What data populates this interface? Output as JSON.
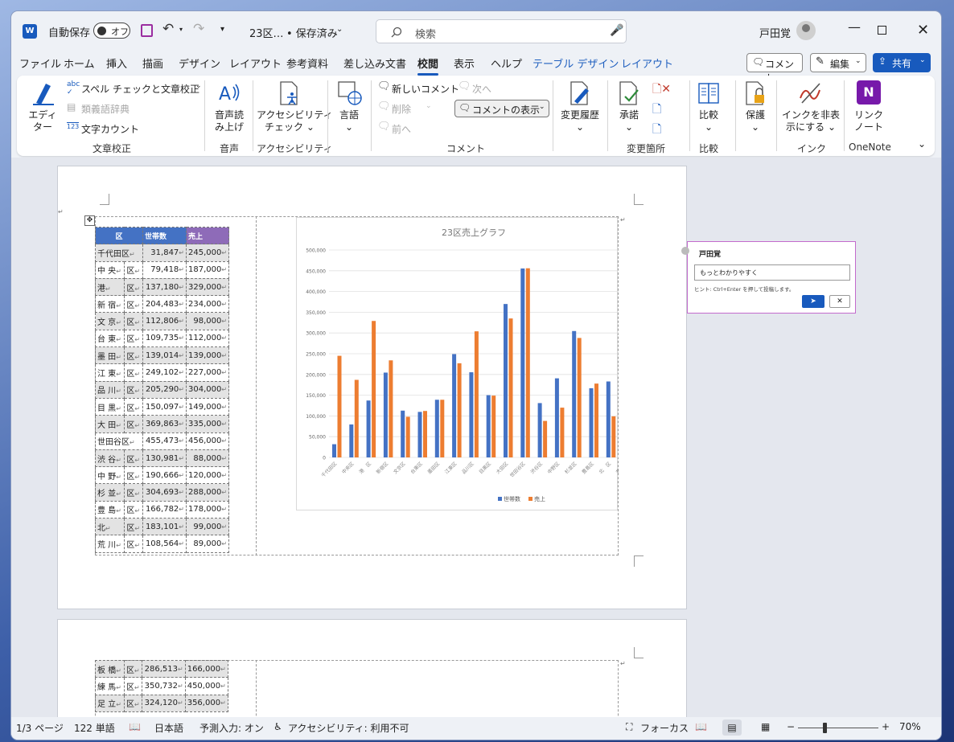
{
  "titlebar": {
    "autosave_label": "自動保存",
    "autosave_state": "オフ",
    "doc_title": "23区…",
    "save_state": "• 保存済み",
    "search_placeholder": "検索",
    "user_name": "戸田覚"
  },
  "tabs": [
    "ファイル",
    "ホーム",
    "挿入",
    "描画",
    "デザイン",
    "レイアウト",
    "参考資料",
    "差し込み文書",
    "校閲",
    "表示",
    "ヘルプ",
    "テーブル デザイン",
    "レイアウト"
  ],
  "tab_right": {
    "comment": "コメント",
    "edit": "編集",
    "share": "共有"
  },
  "ribbon": {
    "proofing": {
      "editor_l1": "エディ",
      "editor_l2": "ター",
      "spell": "スペル チェックと文章校正",
      "thesaurus": "類義語辞典",
      "wordcount": "文字カウント",
      "label": "文章校正"
    },
    "speech": {
      "l1": "音声読",
      "l2": "み上げ",
      "label": "音声"
    },
    "accessibility": {
      "l1": "アクセシビリティ",
      "l2": "チェック",
      "label": "アクセシビリティ"
    },
    "language": {
      "l1": "言語",
      "label": ""
    },
    "comments": {
      "new": "新しいコメント",
      "delete": "削除",
      "prev": "前へ",
      "next": "次へ",
      "show": "コメントの表示",
      "label": "コメント"
    },
    "tracking": {
      "l1": "変更履歴",
      "label": ""
    },
    "changes": {
      "accept": "承諾",
      "label": "変更箇所"
    },
    "compare": {
      "l1": "比較",
      "label": "比較"
    },
    "protect": {
      "l1": "保護",
      "label": ""
    },
    "ink": {
      "l1": "インクを非表",
      "l2": "示にする",
      "label": "インク"
    },
    "onenote": {
      "l1": "リンク",
      "l2": "ノート",
      "label": "OneNote"
    }
  },
  "table": {
    "headers": [
      "区",
      "世帯数",
      "売上"
    ],
    "rows": [
      [
        "千代田区",
        "",
        "31,847",
        "245,000"
      ],
      [
        "中 央",
        "区",
        "79,418",
        "187,000"
      ],
      [
        "港",
        "区",
        "137,180",
        "329,000"
      ],
      [
        "新 宿",
        "区",
        "204,483",
        "234,000"
      ],
      [
        "文 京",
        "区",
        "112,806",
        "98,000"
      ],
      [
        "台 東",
        "区",
        "109,735",
        "112,000"
      ],
      [
        "墨 田",
        "区",
        "139,014",
        "139,000"
      ],
      [
        "江 東",
        "区",
        "249,102",
        "227,000"
      ],
      [
        "品 川",
        "区",
        "205,290",
        "304,000"
      ],
      [
        "目 黒",
        "区",
        "150,097",
        "149,000"
      ],
      [
        "大 田",
        "区",
        "369,863",
        "335,000"
      ],
      [
        "世田谷区",
        "",
        "455,473",
        "456,000"
      ],
      [
        "渋 谷",
        "区",
        "130,981",
        "88,000"
      ],
      [
        "中 野",
        "区",
        "190,666",
        "120,000"
      ],
      [
        "杉 並",
        "区",
        "304,693",
        "288,000"
      ],
      [
        "豊 島",
        "区",
        "166,782",
        "178,000"
      ],
      [
        "北",
        "区",
        "183,101",
        "99,000"
      ],
      [
        "荒 川",
        "区",
        "108,564",
        "89,000"
      ]
    ],
    "page2_rows": [
      [
        "板 橋",
        "区",
        "286,513",
        "166,000"
      ],
      [
        "練 馬",
        "区",
        "350,732",
        "450,000"
      ],
      [
        "足 立",
        "区",
        "324,120",
        "356,000"
      ]
    ]
  },
  "chart_data": {
    "type": "bar",
    "title": "23区売上グラフ",
    "ylim": [
      0,
      500000
    ],
    "yticks": [
      "0",
      "50,000",
      "100,000",
      "150,000",
      "200,000",
      "250,000",
      "300,000",
      "350,000",
      "400,000",
      "450,000",
      "500,000"
    ],
    "categories": [
      "千代田区",
      "中央区",
      "港　区",
      "新宿区",
      "文京区",
      "台東区",
      "墨田区",
      "江東区",
      "品川区",
      "目黒区",
      "大田区",
      "世田谷区",
      "渋谷区",
      "中野区",
      "杉並区",
      "豊島区",
      "北　区",
      "荒川区"
    ],
    "series": [
      {
        "name": "世帯数",
        "color": "#4472c4",
        "values": [
          31847,
          79418,
          137180,
          204483,
          112806,
          109735,
          139014,
          249102,
          205290,
          150097,
          369863,
          455473,
          130981,
          190666,
          304693,
          166782,
          183101,
          182000
        ]
      },
      {
        "name": "売上",
        "color": "#ed7d31",
        "values": [
          245000,
          187000,
          329000,
          234000,
          98000,
          112000,
          139000,
          227000,
          304000,
          149000,
          335000,
          456000,
          88000,
          120000,
          288000,
          178000,
          99000,
          null
        ]
      }
    ],
    "legend": "bottom"
  },
  "comment": {
    "author": "戸田覚",
    "text": "もっとわかりやすく",
    "hint": "ヒント: Ctrl+Enter を押して投稿します。"
  },
  "status": {
    "page": "1/3 ページ",
    "words": "122 単語",
    "lang": "日本語",
    "predict": "予測入力: オン",
    "access": "アクセシビリティ: 利用不可",
    "focus": "フォーカス",
    "zoom": "70%"
  }
}
